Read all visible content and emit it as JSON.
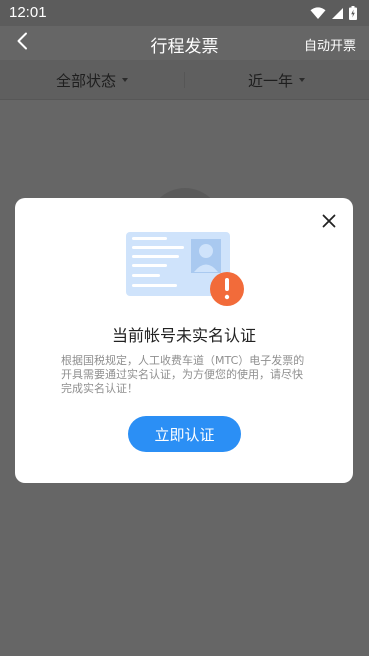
{
  "status_bar": {
    "time": "12:01",
    "icons": [
      "wifi-icon",
      "signal-icon",
      "battery-charging-icon"
    ]
  },
  "nav": {
    "title": "行程发票",
    "action_label": "自动开票",
    "back_icon": "chevron-left-icon"
  },
  "filters": {
    "status_label": "全部状态",
    "period_label": "近一年"
  },
  "modal": {
    "title": "当前帐号未实名认证",
    "description": "根据国税规定，人工收费车道（MTC）电子发票的开具需要通过实名认证，为方便您的使用，请尽快完成实名认证！",
    "button_label": "立即认证",
    "close_icon": "close-icon",
    "illustration_icon": "id-card-warning-icon"
  },
  "colors": {
    "overlay": "#666666",
    "accent": "#2b8ff5",
    "warning": "#f26b3a",
    "card": "#cfe3fb"
  }
}
